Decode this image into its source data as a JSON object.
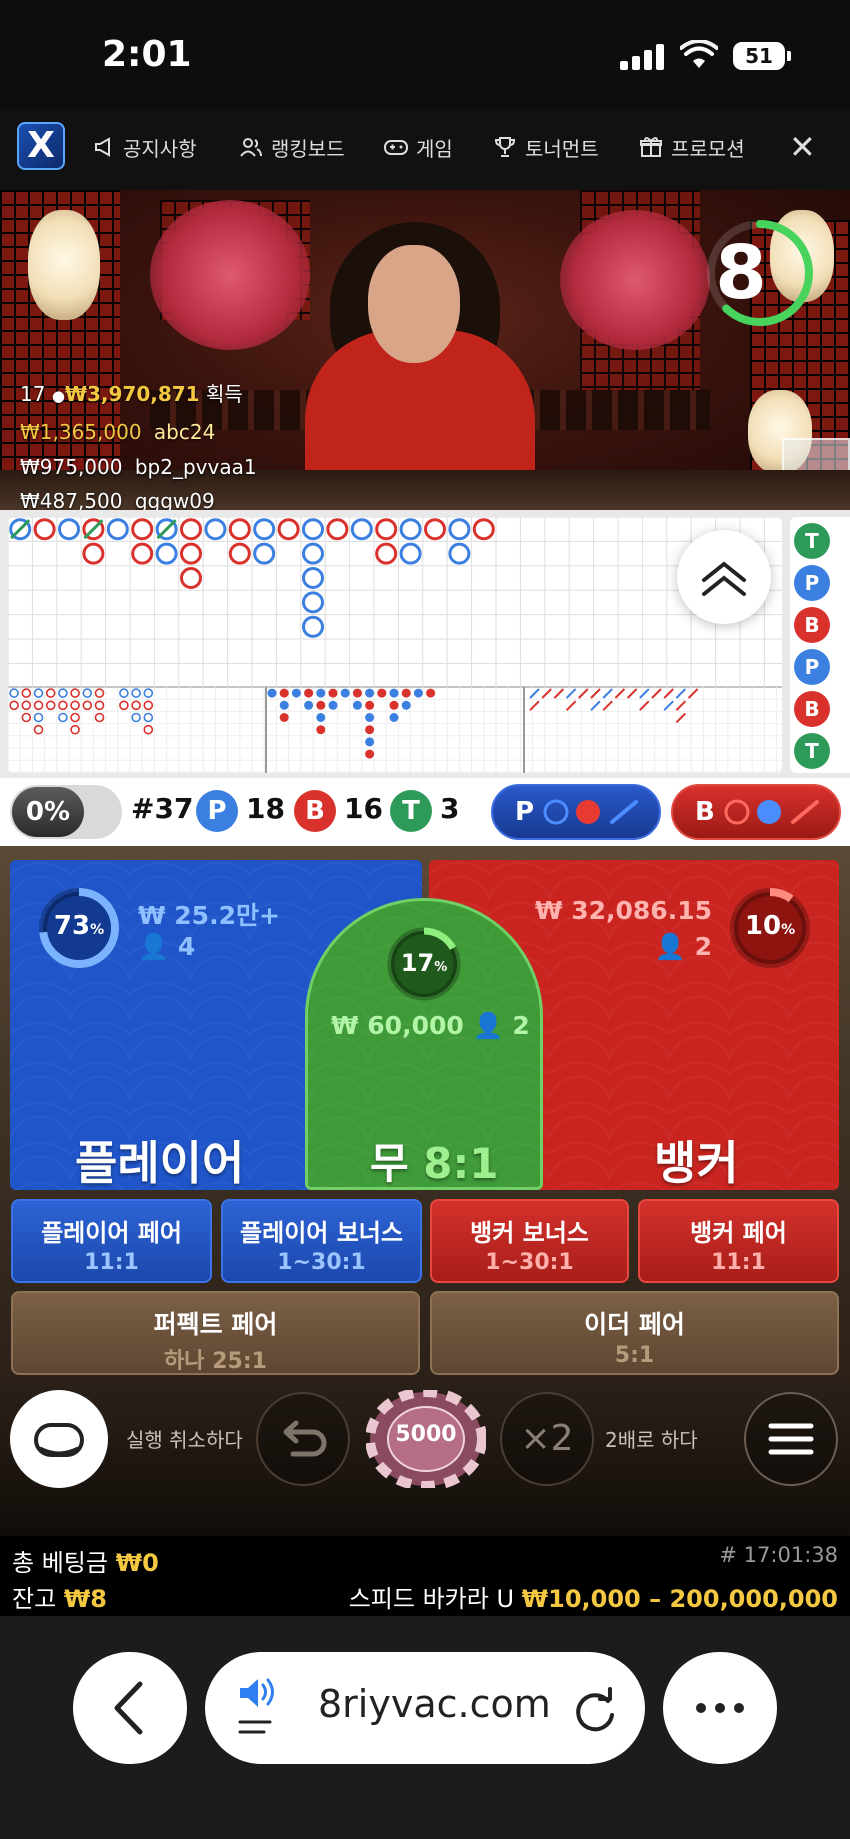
{
  "status_bar": {
    "time": "2:01",
    "battery": "51",
    "icons": [
      "signal-icon",
      "wifi-icon",
      "battery-icon"
    ]
  },
  "nav": {
    "logo": "X",
    "items": [
      {
        "label": "공지사항",
        "icon": "megaphone-icon"
      },
      {
        "label": "랭킹보드",
        "icon": "users-icon"
      },
      {
        "label": "게임",
        "icon": "gamepad-icon"
      },
      {
        "label": "토너먼트",
        "icon": "trophy-icon"
      },
      {
        "label": "프로모션",
        "icon": "gift-icon"
      }
    ],
    "close": "✕"
  },
  "video": {
    "countdown": "8",
    "countdown_fraction": 0.62,
    "winners": {
      "count": "17",
      "total": "₩3,970,871",
      "total_suffix": "획득",
      "rows": [
        {
          "amount": "₩1,365,000",
          "user": "abc24"
        },
        {
          "amount": "₩975,000",
          "user": "bp2_pvvaa1"
        },
        {
          "amount": "₩487,500",
          "user": "gggw09"
        }
      ]
    }
  },
  "road": {
    "side_results": [
      "T",
      "P",
      "B",
      "P",
      "B",
      "T"
    ]
  },
  "stats": {
    "percent": "0%",
    "round": "#37",
    "player_label": "P",
    "player_count": "18",
    "banker_label": "B",
    "banker_count": "16",
    "tie_label": "T",
    "tie_count": "3",
    "player_predict": "P",
    "banker_predict": "B"
  },
  "bets": {
    "player": {
      "label": "플레이어",
      "percent": "73",
      "percent_unit": "%",
      "fraction": 0.73,
      "amount": "₩ 25.2만+",
      "players": "4"
    },
    "tie": {
      "label": "무",
      "odds": "8:1",
      "percent": "17",
      "percent_unit": "%",
      "fraction": 0.17,
      "amount": "₩ 60,000",
      "players": "2"
    },
    "banker": {
      "label": "뱅커",
      "percent": "10",
      "percent_unit": "%",
      "fraction": 0.1,
      "amount": "₩ 32,086.15",
      "players": "2"
    },
    "side": [
      {
        "label": "플레이어 페어",
        "odds": "11:1"
      },
      {
        "label": "플레이어 보너스",
        "odds": "1~30:1"
      },
      {
        "label": "뱅커 보너스",
        "odds": "1~30:1"
      },
      {
        "label": "뱅커 페어",
        "odds": "11:1"
      }
    ],
    "perfect_pair": {
      "label": "퍼펙트 페어",
      "odds": "하나 25:1"
    },
    "either_pair": {
      "label": "이더 페어",
      "odds": "5:1"
    }
  },
  "controls": {
    "undo_label": "실행 취소하다",
    "chip": "5000",
    "double_icon": "×2",
    "double_label": "2배로 하다"
  },
  "info": {
    "total_bet_label": "총 베팅금",
    "total_bet": "₩0",
    "balance_label": "잔고",
    "balance": "₩8",
    "timestamp": "# 17:01:38",
    "table_name": "스피드 바카라 U",
    "limits": "₩10,000 – 200,000,000"
  },
  "browser": {
    "url": "8riyvac.com"
  },
  "colors": {
    "player": "#1f55c9",
    "banker": "#d12a24",
    "tie": "#2f8f2f",
    "gold": "#f5c842"
  }
}
